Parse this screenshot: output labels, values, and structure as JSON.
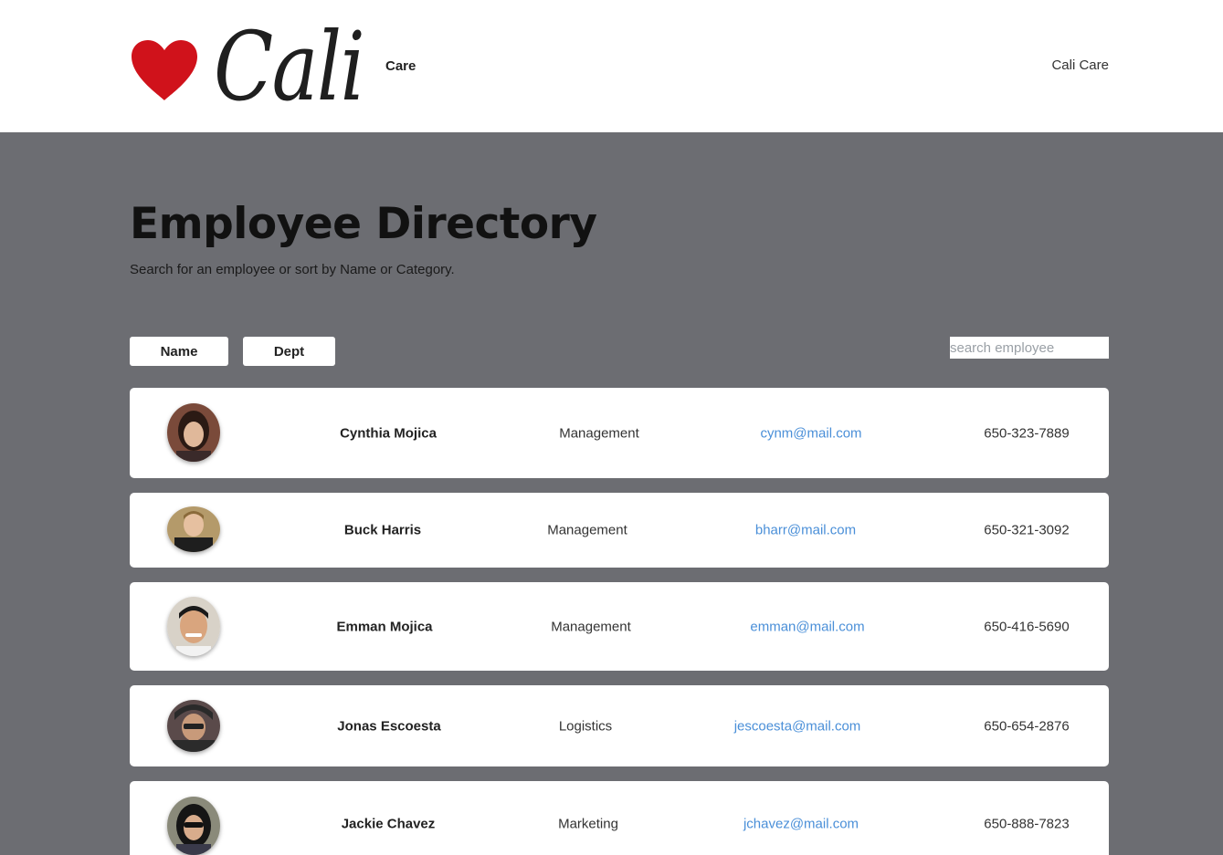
{
  "brand": {
    "logo_text": "Cali",
    "small_text": "Care",
    "heart_color": "#d0121b"
  },
  "nav": {
    "link": "Cali Care"
  },
  "hero": {
    "title": "Employee Directory",
    "subtitle": "Search for an employee or sort by Name or Category."
  },
  "controls": {
    "sort_name": "Name",
    "sort_dept": "Dept",
    "search_placeholder": "search employee"
  },
  "employees": [
    {
      "name": "Cynthia Mojica",
      "dept": "Management",
      "email": "cynm@mail.com",
      "phone": "650-323-7889"
    },
    {
      "name": "Buck Harris",
      "dept": "Management",
      "email": "bharr@mail.com",
      "phone": "650-321-3092"
    },
    {
      "name": "Emman Mojica",
      "dept": "Management",
      "email": "emman@mail.com",
      "phone": "650-416-5690"
    },
    {
      "name": "Jonas Escoesta",
      "dept": "Logistics",
      "email": "jescoesta@mail.com",
      "phone": "650-654-2876"
    },
    {
      "name": "Jackie Chavez",
      "dept": "Marketing",
      "email": "jchavez@mail.com",
      "phone": "650-888-7823"
    }
  ],
  "colors": {
    "background": "#6c6d72",
    "email_link": "#4a8fd8"
  }
}
